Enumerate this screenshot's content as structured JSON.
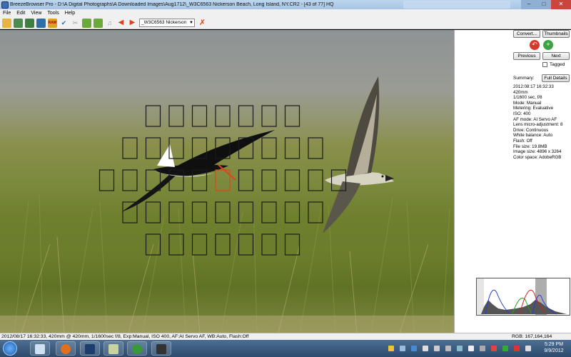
{
  "window": {
    "title": "BreezeBrowser Pro - D:\\A Digital Photographs\\A Downloaded Images\\Aug1712\\_W3C6563  Nickerson Beach, Long Island, NY.CR2 - [43 of 77] HQ",
    "min_icon": "minimize-icon",
    "max_icon": "maximize-icon",
    "close_icon": "close-icon"
  },
  "menu": [
    "File",
    "Edit",
    "View",
    "Tools",
    "Help"
  ],
  "toolbar": {
    "file_select_value": "_W3C6563  Nickerson",
    "raw_label": "RAW"
  },
  "photo": {
    "af_grid_rows": [
      7,
      9,
      11,
      9,
      7
    ],
    "active_af_point": {
      "row": 2,
      "col": 5
    },
    "colors": {
      "af_point": "#1a1a1a",
      "af_active": "#e0451a"
    }
  },
  "panel": {
    "convert_label": "Convert...",
    "thumbnails_label": "Thumbnails",
    "previous_label": "Previous",
    "next_label": "Next",
    "tagged_label": "Tagged",
    "summary_label": "Summary:",
    "full_details_label": "Full Details",
    "details": [
      "2012:08:17 16:32:33",
      "420mm",
      "1/1600 sec, f/8",
      "Mode: Manual",
      "Metering: Evaluative",
      "ISO: 400",
      "AF mode: AI Servo AF",
      "Lens micro-adjustment: 8",
      "Drive: Continuous",
      "White balance: Auto",
      "Flash: Off",
      "File size: 19.8MB",
      "Image size: 4896 x 3264",
      "Color space: AdobeRGB"
    ]
  },
  "status": {
    "text": "2012/08/17 16:32:33, 420mm @ 420mm, 1/1600sec f/8, Exp:Manual, ISO 400, AF:AI Servo AF, WB:Auto, Flash:Off",
    "rgb": "RGB: 167,164,164"
  },
  "taskbar": {
    "time": "5:29 PM",
    "date": "9/9/2012"
  }
}
